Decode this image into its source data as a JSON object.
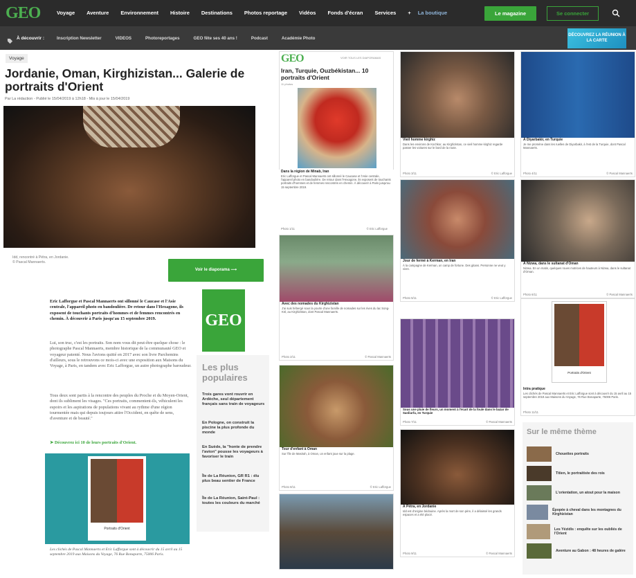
{
  "nav": {
    "logo": "GEO",
    "items": [
      "Voyage",
      "Aventure",
      "Environnement",
      "Histoire",
      "Destinations",
      "Photos reportage",
      "Vidéos",
      "Fonds d'écran",
      "Services",
      "+"
    ],
    "boutique": "La boutique",
    "magazine": "Le magazine",
    "login": "Se connecter",
    "search_icon": "search-icon"
  },
  "subnav": {
    "discover": "À découvrir :",
    "items": [
      "Inscription Newsletter",
      "VIDEOS",
      "Photoreportages",
      "GEO fête ses 40 ans !",
      "Podcast",
      "Académie Photo"
    ],
    "promo": "DÉCOUVREZ LA RÉUNION À LA CARTE"
  },
  "article": {
    "tag": "Voyage",
    "title": "Jordanie, Oman, Kirghizistan... Galerie de portraits d'Orient",
    "meta": "Par La rédaction - Publié le 15/04/2019 à 12h18 - Mis à jour le 15/04/2019",
    "caption1": "Idd, rencontré à Pétra, en Jordanie.",
    "caption2": "© Pascal Mannaerts.",
    "diaporama": "Voir le diaporama",
    "intro": "Eric Lafforgue et Pascal Mannaerts ont sillonné le Caucase et l'Asie centrale, l'appareil photo en bandoulière. De retour dans l'Hexagone, ils exposent de touchants portraits d'hommes et de femmes rencontrés en chemin. À découvrir à Paris jusqu'au 15 septembre 2019.",
    "p1": "Lui, son truc, c'est les portraits. Son nom vous dit peut-être quelque chose : le photographe Pascal Mannaerts, membre historique de la communauté GEO et voyageur patenté. Nous l'avions quitté en 2017 avec son livre Parchemins d'ailleurs, sous le retrouvons ce mois-ci avec une exposition aux Maisons du Voyage, à Paris, en tandem avec Eric Lafforgue, un autre photographe baroudeur.",
    "p2": "Tous deux sont partis à la rencontre des peuples du Proche et du Moyen-Orient, dont ils subliment les visages. \"Ces portraits, commentent-ils, véhiculent les espoirs et les aspirations de populations vivant au rythme d'une région tourmentée mais qui depuis toujours attire l'Occident, en quête de sens, d'aventure et de beauté.\"",
    "discover": "➤ Découvrez ici 10 de leurs portraits d'Orient.",
    "poster_title": "Portraits d'Orient",
    "caption_bottom": "Les clichés de Pascal Mannaerts et Eric Lafforgue sont à découvrir du 15 avril au 15 septembre 2019 aux Maisons du Voyage, 76 Rue Bonaparte, 75006 Paris."
  },
  "ad": {
    "logo": "GEO"
  },
  "popular": {
    "title": "Les plus populaires",
    "items": [
      "Trois gares vont rouvrir en Ardèche, seul département français sans train de voyageurs",
      "En Pologne, on construit la piscine la plus profonde du monde",
      "En Suède, la \"honte de prendre l'avion\" pousse les voyageurs à favoriser le train",
      "Île de La Réunion, GR R1 : élu plus beau sentier de France",
      "Île de La Réunion, Saint-Paul : toutes les couleurs du marché"
    ]
  },
  "gallery": {
    "logo": "GEO",
    "see_all": "VOIR TOUS LES DIAPORAMAS",
    "title": "Iran, Turquie, Ouzbékistan... 10 portraits d'Orient",
    "count": "11 photos",
    "cards": [
      {
        "cap": "Dans la région de Minab, Iran",
        "desc": "Eric Lafforgue et Pascal Mannaerts ont sillonné le Caucase et l'Asie centrale, l'appareil photo en bandoulière. De retour dans l'Hexagone, ils exposent de touchants portraits d'hommes et de femmes rencontrés en chemin. À découvrir à Paris jusqu'au 15 septembre 2019.",
        "photo": "Photo 1/11",
        "credit": "© Eric Lafforgue"
      },
      {
        "cap": "Avec des nomades du Kirghizistan",
        "desc": "J'ai suis hébergé sous la yourte d'une famille de nomades sur les rives du lac Song-Köl, au Kirghizistan, dont Pascal Mannaerts.",
        "photo": "Photo 2/11",
        "credit": "© Pascal Mannaerts"
      },
      {
        "cap": "Vieil homme kirghiz",
        "desc": "Dans les environs de Kochkor, au Kirghizistan, ce vieil homme kirghiz regarde passer les voitures sur le bord de la route.",
        "photo": "Photo 3/11",
        "credit": "© Eric Lafforgue"
      },
      {
        "cap": "À Diyarbakir, en Turquie",
        "desc": "Je me promène dans les ruelles de Diyarbakir, à l'est de la Turquie, dont Pascal Mannaerts.",
        "photo": "Photo 4/11",
        "credit": "© Pascal Mannaerts"
      },
      {
        "cap": "Jour de fermé à Kerman, en Iran",
        "desc": "À la campagne de Kerman, un camp de fortune. Des gitans. Personne ne veut y vivre.",
        "photo": "Photo 5/11",
        "credit": "© Eric Lafforgue"
      },
      {
        "cap": "À Nizwa, dans le sultanat d'Oman",
        "desc": "Nizwa. En un matin, quelques roues motrices de hauteurs à Nizwa, dans le sultanat d'Oman.",
        "photo": "Photo 6/11",
        "credit": "© Pascal Mannaerts"
      },
      {
        "cap": "Sous une pluie de fleurs, un moment à l'écart de la foule dans le bazar de Sanliurfa, en Turquie",
        "desc": "",
        "photo": "Photo 7/11",
        "credit": "© Pascal Mannaerts"
      },
      {
        "cap": "Intra pratique",
        "desc": "Les clichés de Pascal Mannaerts et Eric Lafforgue sont à découvrir du 15 avril au 15 septembre 2019 aux Maisons du Voyage, 76 Rue Bonaparte, 75006 Paris.",
        "photo": "Photo 11/11",
        "credit": "",
        "poster": "Portraits d'Orient"
      },
      {
        "cap": "Tour d'enfant à Oman",
        "desc": "Sur l'île de Masirah, à Oman, un enfant joue sur la plage.",
        "photo": "Photo 8/11",
        "credit": "© Eric Lafforgue"
      },
      {
        "cap": "À Pétra, en Jordanie",
        "desc": "Idd est d'origine bédouine. Après la mort de son père, il a délaissé les grands espaces et a été placé.",
        "photo": "Photo 9/11",
        "credit": "© Pascal Mannaerts"
      }
    ]
  },
  "theme": {
    "title": "Sur le même thème",
    "items": [
      "Chouettes portraits",
      "Titien, le portraitiste des rois",
      "L'orientation, un atout pour la maison",
      "Épopée à cheval dans les montagnes du Kirghizistan",
      "Les Yézidis : enquête sur les oubliés de l'Orient",
      "Aventure au Gabon : 48 heures de galère"
    ]
  }
}
